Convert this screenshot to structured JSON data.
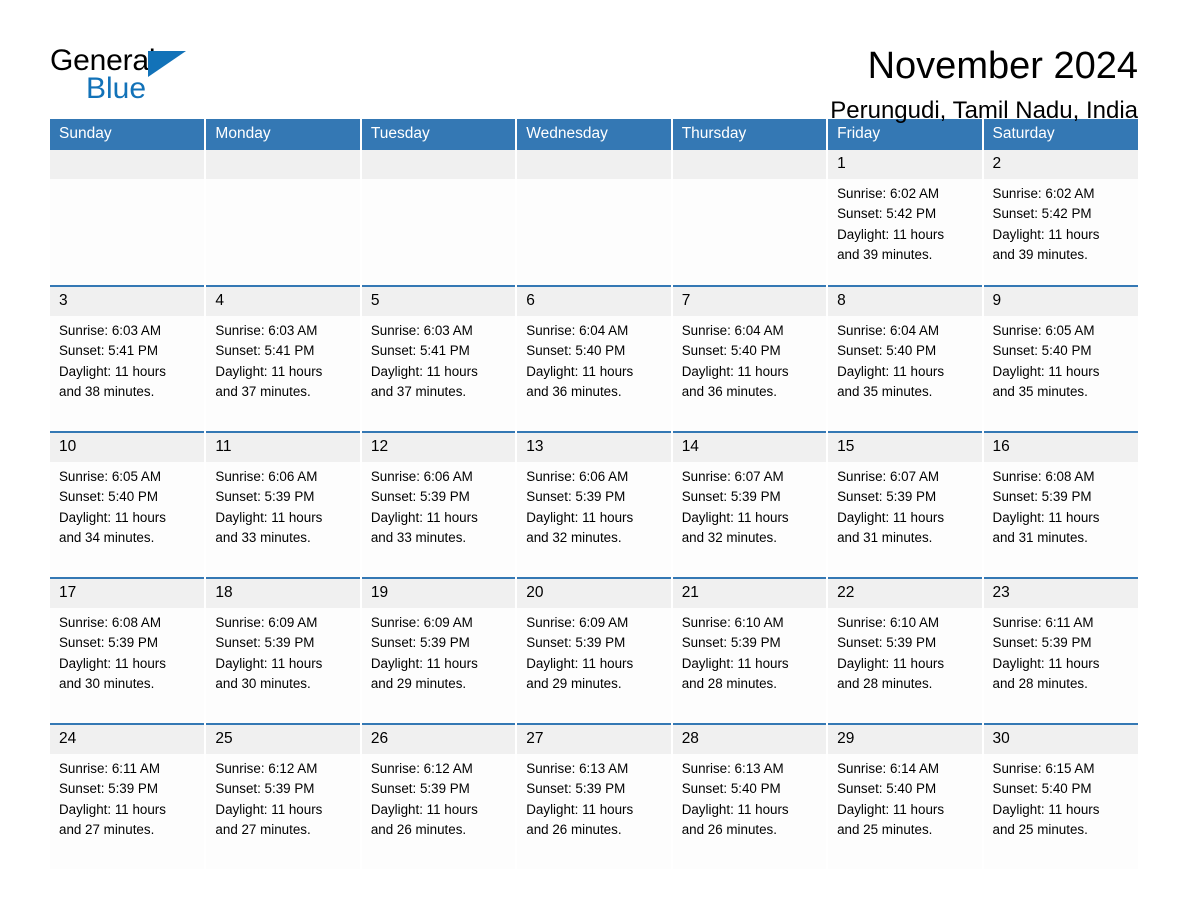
{
  "brand": {
    "name_part1": "General",
    "name_part2": "Blue",
    "triangle_icon": "blue-triangle-icon",
    "accent_color": "#1272B8"
  },
  "header": {
    "title": "November 2024",
    "subtitle": "Perungudi, Tamil Nadu, India",
    "header_bg_color": "#3478B4",
    "daynum_bg_color": "#F0F0F0"
  },
  "weekday_headers": [
    "Sunday",
    "Monday",
    "Tuesday",
    "Wednesday",
    "Thursday",
    "Friday",
    "Saturday"
  ],
  "weeks": [
    [
      {
        "day": "",
        "sunrise": "",
        "sunset": "",
        "daylight_line1": "",
        "daylight_line2": ""
      },
      {
        "day": "",
        "sunrise": "",
        "sunset": "",
        "daylight_line1": "",
        "daylight_line2": ""
      },
      {
        "day": "",
        "sunrise": "",
        "sunset": "",
        "daylight_line1": "",
        "daylight_line2": ""
      },
      {
        "day": "",
        "sunrise": "",
        "sunset": "",
        "daylight_line1": "",
        "daylight_line2": ""
      },
      {
        "day": "",
        "sunrise": "",
        "sunset": "",
        "daylight_line1": "",
        "daylight_line2": ""
      },
      {
        "day": "1",
        "sunrise": "Sunrise: 6:02 AM",
        "sunset": "Sunset: 5:42 PM",
        "daylight_line1": "Daylight: 11 hours",
        "daylight_line2": "and 39 minutes."
      },
      {
        "day": "2",
        "sunrise": "Sunrise: 6:02 AM",
        "sunset": "Sunset: 5:42 PM",
        "daylight_line1": "Daylight: 11 hours",
        "daylight_line2": "and 39 minutes."
      }
    ],
    [
      {
        "day": "3",
        "sunrise": "Sunrise: 6:03 AM",
        "sunset": "Sunset: 5:41 PM",
        "daylight_line1": "Daylight: 11 hours",
        "daylight_line2": "and 38 minutes."
      },
      {
        "day": "4",
        "sunrise": "Sunrise: 6:03 AM",
        "sunset": "Sunset: 5:41 PM",
        "daylight_line1": "Daylight: 11 hours",
        "daylight_line2": "and 37 minutes."
      },
      {
        "day": "5",
        "sunrise": "Sunrise: 6:03 AM",
        "sunset": "Sunset: 5:41 PM",
        "daylight_line1": "Daylight: 11 hours",
        "daylight_line2": "and 37 minutes."
      },
      {
        "day": "6",
        "sunrise": "Sunrise: 6:04 AM",
        "sunset": "Sunset: 5:40 PM",
        "daylight_line1": "Daylight: 11 hours",
        "daylight_line2": "and 36 minutes."
      },
      {
        "day": "7",
        "sunrise": "Sunrise: 6:04 AM",
        "sunset": "Sunset: 5:40 PM",
        "daylight_line1": "Daylight: 11 hours",
        "daylight_line2": "and 36 minutes."
      },
      {
        "day": "8",
        "sunrise": "Sunrise: 6:04 AM",
        "sunset": "Sunset: 5:40 PM",
        "daylight_line1": "Daylight: 11 hours",
        "daylight_line2": "and 35 minutes."
      },
      {
        "day": "9",
        "sunrise": "Sunrise: 6:05 AM",
        "sunset": "Sunset: 5:40 PM",
        "daylight_line1": "Daylight: 11 hours",
        "daylight_line2": "and 35 minutes."
      }
    ],
    [
      {
        "day": "10",
        "sunrise": "Sunrise: 6:05 AM",
        "sunset": "Sunset: 5:40 PM",
        "daylight_line1": "Daylight: 11 hours",
        "daylight_line2": "and 34 minutes."
      },
      {
        "day": "11",
        "sunrise": "Sunrise: 6:06 AM",
        "sunset": "Sunset: 5:39 PM",
        "daylight_line1": "Daylight: 11 hours",
        "daylight_line2": "and 33 minutes."
      },
      {
        "day": "12",
        "sunrise": "Sunrise: 6:06 AM",
        "sunset": "Sunset: 5:39 PM",
        "daylight_line1": "Daylight: 11 hours",
        "daylight_line2": "and 33 minutes."
      },
      {
        "day": "13",
        "sunrise": "Sunrise: 6:06 AM",
        "sunset": "Sunset: 5:39 PM",
        "daylight_line1": "Daylight: 11 hours",
        "daylight_line2": "and 32 minutes."
      },
      {
        "day": "14",
        "sunrise": "Sunrise: 6:07 AM",
        "sunset": "Sunset: 5:39 PM",
        "daylight_line1": "Daylight: 11 hours",
        "daylight_line2": "and 32 minutes."
      },
      {
        "day": "15",
        "sunrise": "Sunrise: 6:07 AM",
        "sunset": "Sunset: 5:39 PM",
        "daylight_line1": "Daylight: 11 hours",
        "daylight_line2": "and 31 minutes."
      },
      {
        "day": "16",
        "sunrise": "Sunrise: 6:08 AM",
        "sunset": "Sunset: 5:39 PM",
        "daylight_line1": "Daylight: 11 hours",
        "daylight_line2": "and 31 minutes."
      }
    ],
    [
      {
        "day": "17",
        "sunrise": "Sunrise: 6:08 AM",
        "sunset": "Sunset: 5:39 PM",
        "daylight_line1": "Daylight: 11 hours",
        "daylight_line2": "and 30 minutes."
      },
      {
        "day": "18",
        "sunrise": "Sunrise: 6:09 AM",
        "sunset": "Sunset: 5:39 PM",
        "daylight_line1": "Daylight: 11 hours",
        "daylight_line2": "and 30 minutes."
      },
      {
        "day": "19",
        "sunrise": "Sunrise: 6:09 AM",
        "sunset": "Sunset: 5:39 PM",
        "daylight_line1": "Daylight: 11 hours",
        "daylight_line2": "and 29 minutes."
      },
      {
        "day": "20",
        "sunrise": "Sunrise: 6:09 AM",
        "sunset": "Sunset: 5:39 PM",
        "daylight_line1": "Daylight: 11 hours",
        "daylight_line2": "and 29 minutes."
      },
      {
        "day": "21",
        "sunrise": "Sunrise: 6:10 AM",
        "sunset": "Sunset: 5:39 PM",
        "daylight_line1": "Daylight: 11 hours",
        "daylight_line2": "and 28 minutes."
      },
      {
        "day": "22",
        "sunrise": "Sunrise: 6:10 AM",
        "sunset": "Sunset: 5:39 PM",
        "daylight_line1": "Daylight: 11 hours",
        "daylight_line2": "and 28 minutes."
      },
      {
        "day": "23",
        "sunrise": "Sunrise: 6:11 AM",
        "sunset": "Sunset: 5:39 PM",
        "daylight_line1": "Daylight: 11 hours",
        "daylight_line2": "and 28 minutes."
      }
    ],
    [
      {
        "day": "24",
        "sunrise": "Sunrise: 6:11 AM",
        "sunset": "Sunset: 5:39 PM",
        "daylight_line1": "Daylight: 11 hours",
        "daylight_line2": "and 27 minutes."
      },
      {
        "day": "25",
        "sunrise": "Sunrise: 6:12 AM",
        "sunset": "Sunset: 5:39 PM",
        "daylight_line1": "Daylight: 11 hours",
        "daylight_line2": "and 27 minutes."
      },
      {
        "day": "26",
        "sunrise": "Sunrise: 6:12 AM",
        "sunset": "Sunset: 5:39 PM",
        "daylight_line1": "Daylight: 11 hours",
        "daylight_line2": "and 26 minutes."
      },
      {
        "day": "27",
        "sunrise": "Sunrise: 6:13 AM",
        "sunset": "Sunset: 5:39 PM",
        "daylight_line1": "Daylight: 11 hours",
        "daylight_line2": "and 26 minutes."
      },
      {
        "day": "28",
        "sunrise": "Sunrise: 6:13 AM",
        "sunset": "Sunset: 5:40 PM",
        "daylight_line1": "Daylight: 11 hours",
        "daylight_line2": "and 26 minutes."
      },
      {
        "day": "29",
        "sunrise": "Sunrise: 6:14 AM",
        "sunset": "Sunset: 5:40 PM",
        "daylight_line1": "Daylight: 11 hours",
        "daylight_line2": "and 25 minutes."
      },
      {
        "day": "30",
        "sunrise": "Sunrise: 6:15 AM",
        "sunset": "Sunset: 5:40 PM",
        "daylight_line1": "Daylight: 11 hours",
        "daylight_line2": "and 25 minutes."
      }
    ]
  ]
}
